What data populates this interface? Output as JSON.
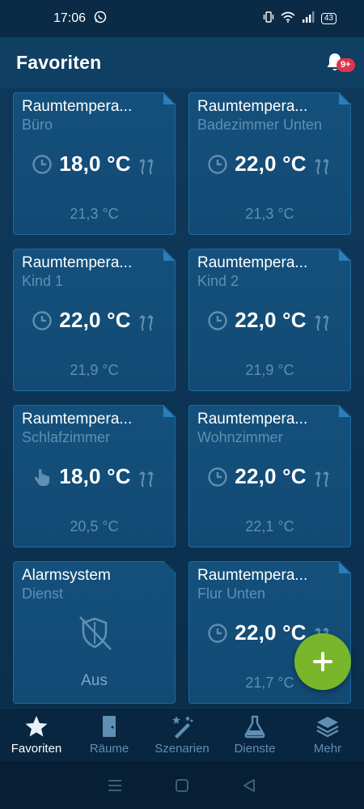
{
  "status": {
    "time": "17:06",
    "battery": "43"
  },
  "header": {
    "title": "Favoriten",
    "notification_count": "9+"
  },
  "cards": [
    {
      "title": "Raumtempera...",
      "room": "Büro",
      "setpoint": "18,0 °C",
      "actual": "21,3 °C",
      "mode": "schedule"
    },
    {
      "title": "Raumtempera...",
      "room": "Badezimmer Unten",
      "setpoint": "22,0 °C",
      "actual": "21,3 °C",
      "mode": "schedule"
    },
    {
      "title": "Raumtempera...",
      "room": "Kind 1",
      "setpoint": "22,0 °C",
      "actual": "21,9 °C",
      "mode": "schedule"
    },
    {
      "title": "Raumtempera...",
      "room": "Kind 2",
      "setpoint": "22,0 °C",
      "actual": "21,9 °C",
      "mode": "schedule"
    },
    {
      "title": "Raumtempera...",
      "room": "Schlafzimmer",
      "setpoint": "18,0 °C",
      "actual": "20,5 °C",
      "mode": "manual"
    },
    {
      "title": "Raumtempera...",
      "room": "Wohnzimmer",
      "setpoint": "22,0 °C",
      "actual": "22,1 °C",
      "mode": "schedule"
    },
    {
      "title": "Alarmsystem",
      "room": "Dienst",
      "state": "Aus"
    },
    {
      "title": "Raumtempera...",
      "room": "Flur Unten",
      "setpoint": "22,0 °C",
      "actual": "21,7 °C",
      "mode": "schedule"
    }
  ],
  "bottom_nav": [
    {
      "label": "Favoriten",
      "icon": "star-icon",
      "active": true
    },
    {
      "label": "Räume",
      "icon": "door-icon",
      "active": false
    },
    {
      "label": "Szenarien",
      "icon": "magic-wand-icon",
      "active": false
    },
    {
      "label": "Dienste",
      "icon": "flask-icon",
      "active": false
    },
    {
      "label": "Mehr",
      "icon": "layers-icon",
      "active": false
    }
  ],
  "colors": {
    "accent_green": "#79b62b",
    "badge_red": "#e2334a",
    "muted_blue": "#5f8fb3"
  }
}
